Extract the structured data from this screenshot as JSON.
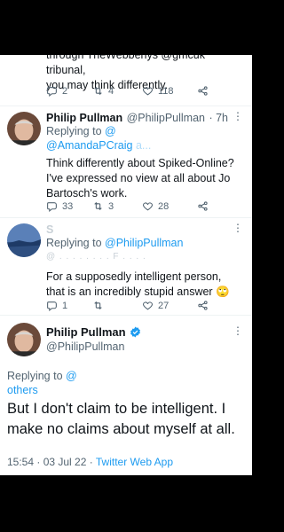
{
  "tweet0": {
    "text_partial_top": "through TheWebbenys @gmcuk tribunal,",
    "text_line2": "you may think differently.",
    "replies": "2",
    "retweets": "4",
    "likes": "118"
  },
  "tweet1": {
    "name": "Philip Pullman",
    "handle": "@PhilipPullman",
    "time": "· 7h",
    "reply_prefix": "Replying to",
    "reply_handle1": "@",
    "reply_handle2": "@AmandaPCraig",
    "reply_handle2_tail": "a...",
    "text": "Think differently about Spiked-Online? I've expressed no view at all about Jo Bartosch's work.",
    "replies": "33",
    "retweets": "3",
    "likes": "28"
  },
  "tweet2": {
    "name": "S",
    "reply_prefix": "Replying to",
    "reply_handle": "@PhilipPullman",
    "obscured_line": "@ . . . . . . . . F . . . .",
    "text": "For a supposedly intelligent person, that is an incredibly stupid answer",
    "emoji": "🙄",
    "replies": "1",
    "retweets": "",
    "likes": "27"
  },
  "main_tweet": {
    "name": "Philip Pullman",
    "handle": "@PhilipPullman",
    "reply_prefix": "Replying to",
    "reply_handle": "@",
    "reply_others": "others",
    "text": "But I don't claim to be intelligent. I make no claims about myself at all.",
    "timestamp": "15:54 · 03 Jul 22 ·",
    "source": "Twitter Web App"
  },
  "colors": {
    "accent": "#1d9bf0",
    "secondary_text": "#536471",
    "verified": "#1d9bf0"
  },
  "icons": [
    "reply-icon",
    "retweet-icon",
    "like-icon",
    "share-icon",
    "verified-badge-icon",
    "more-icon"
  ]
}
